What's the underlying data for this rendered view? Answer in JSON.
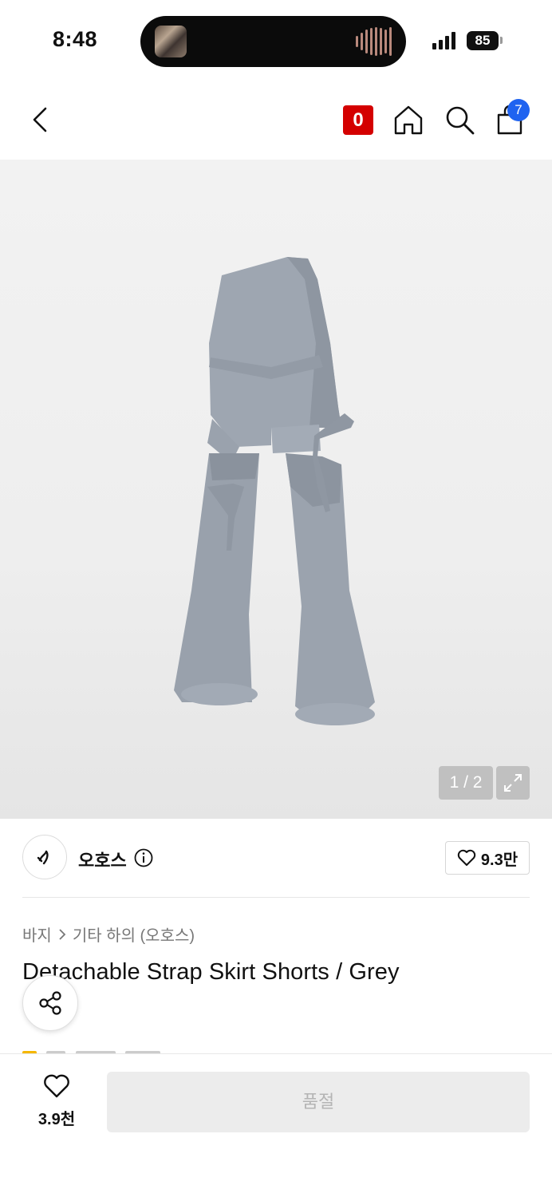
{
  "status_bar": {
    "time": "8:48",
    "battery": "85"
  },
  "header": {
    "points_badge": "0",
    "cart_count": "7"
  },
  "gallery": {
    "current": "1",
    "total": "2",
    "pager_text": "1 / 2"
  },
  "brand": {
    "name": "오호스",
    "likes": "9.3만"
  },
  "breadcrumb": {
    "category": "바지",
    "subcategory": "기타 하의 (오호스)"
  },
  "product": {
    "title": "Detachable Strap Skirt Shorts / Grey"
  },
  "bottom_bar": {
    "wish_count": "3.9천",
    "buy_label": "품절"
  },
  "colors": {
    "accent_red": "#d40000",
    "badge_blue": "#1f63f0",
    "garment": "#9aa3ae"
  },
  "icons": [
    "back-arrow-icon",
    "home-icon",
    "search-icon",
    "bag-icon",
    "expand-icon",
    "brand-logo",
    "info-icon",
    "heart-icon",
    "share-icon",
    "chevron-right-icon"
  ]
}
